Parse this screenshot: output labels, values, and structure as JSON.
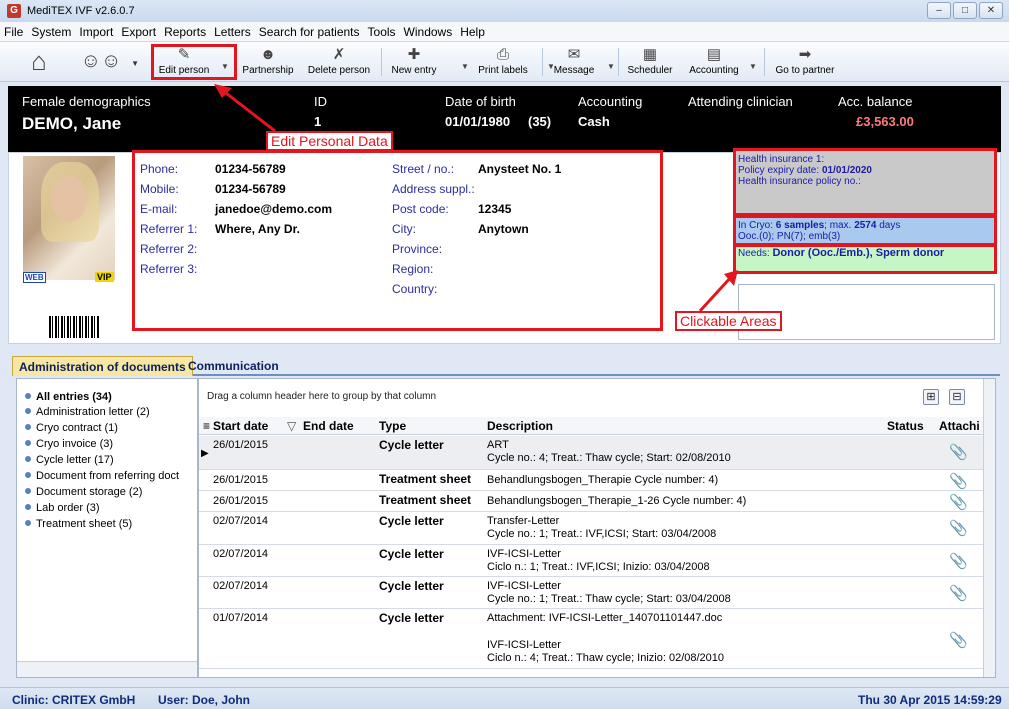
{
  "window": {
    "title": "MediTEX IVF v2.6.0.7",
    "app_icon": "G"
  },
  "menu": [
    "File",
    "System",
    "Import",
    "Export",
    "Reports",
    "Letters",
    "Search for patients",
    "Tools",
    "Windows",
    "Help"
  ],
  "toolbar": {
    "edit_person": "Edit person",
    "partnership": "Partnership",
    "delete_person": "Delete person",
    "new_entry": "New entry",
    "print_labels": "Print labels",
    "message": "Message",
    "scheduler": "Scheduler",
    "accounting": "Accounting",
    "go_to_partner": "Go to partner"
  },
  "header": {
    "demographics_label": "Female demographics",
    "name": "DEMO, Jane",
    "id_label": "ID",
    "id_value": "1",
    "dob_label": "Date of birth",
    "dob_value": "01/01/1980",
    "age": "(35)",
    "accounting_label": "Accounting",
    "accounting_value": "Cash",
    "clinician_label": "Attending clinician",
    "balance_label": "Acc. balance",
    "balance_value": "£3,563.00"
  },
  "badges": {
    "web": "WEB",
    "vip": "VIP"
  },
  "contact": {
    "phone_label": "Phone:",
    "phone": "01234-56789",
    "mobile_label": "Mobile:",
    "mobile": "01234-56789",
    "email_label": "E-mail:",
    "email": "janedoe@demo.com",
    "ref1_label": "Referrer 1:",
    "ref1": "Where, Any Dr.",
    "ref2_label": "Referrer 2:",
    "ref3_label": "Referrer 3:",
    "street_label": "Street / no.:",
    "street": "Anysteet No. 1",
    "address_label": "Address suppl.:",
    "postcode_label": "Post code:",
    "postcode": "12345",
    "city_label": "City:",
    "city": "Anytown",
    "province_label": "Province:",
    "region_label": "Region:",
    "country_label": "Country:"
  },
  "insurance": {
    "line1": "Health insurance 1:",
    "policy_expiry_label": "Policy expiry date:",
    "policy_expiry": "01/01/2020",
    "policy_no": "Health insurance policy no.:"
  },
  "cryo": {
    "line1_prefix": "In Cryo: ",
    "samples": "6 samples",
    "max_text": "; max. ",
    "max_days": "2574",
    "days": " days",
    "line2_prefix": "Ooc.(0); PN(",
    "pn": "7",
    "line2_suffix": "); emb(3)"
  },
  "needs": {
    "label": "Needs: ",
    "value": "Donor (Ooc./Emb.), Sperm donor"
  },
  "annotations": {
    "edit": "Edit Personal Data",
    "clickable": "Clickable Areas"
  },
  "tabs": [
    "Administration of documents",
    "Communication"
  ],
  "doc_tree": [
    "All entries (34)",
    "Administration letter (2)",
    "Cryo contract (1)",
    "Cryo invoice (3)",
    "Cycle letter (17)",
    "Document from referring doct",
    "Document storage (2)",
    "Lab order (3)",
    "Treatment sheet (5)"
  ],
  "grid": {
    "group_hint": "Drag a column header here to group by that column",
    "headers": {
      "start": "Start date",
      "end": "End date",
      "type": "Type",
      "desc": "Description",
      "status": "Status",
      "attach": "Attachi"
    },
    "rows": [
      {
        "start": "26/01/2015",
        "type": "Cycle letter",
        "desc1": "ART",
        "desc2": "Cycle no.: 4; Treat.: Thaw cycle; Start: 02/08/2010",
        "desc3": ""
      },
      {
        "start": "26/01/2015",
        "type": "Treatment sheet",
        "desc1": "Behandlungsbogen_Therapie Cycle number: 4)",
        "desc2": "",
        "desc3": ""
      },
      {
        "start": "26/01/2015",
        "type": "Treatment sheet",
        "desc1": "Behandlungsbogen_Therapie_1-26 Cycle number: 4)",
        "desc2": "",
        "desc3": ""
      },
      {
        "start": "02/07/2014",
        "type": "Cycle letter",
        "desc1": "Transfer-Letter",
        "desc2": "Cycle no.: 1; Treat.: IVF,ICSI; Start: 03/04/2008",
        "desc3": ""
      },
      {
        "start": "02/07/2014",
        "type": "Cycle letter",
        "desc1": "IVF-ICSI-Letter",
        "desc2": "Ciclo n.: 1; Treat.: IVF,ICSI; Inizio:  03/04/2008",
        "desc3": ""
      },
      {
        "start": "02/07/2014",
        "type": "Cycle letter",
        "desc1": "IVF-ICSI-Letter",
        "desc2": "Cycle no.: 1; Treat.: Thaw cycle; Start: 03/04/2008",
        "desc3": ""
      },
      {
        "start": "01/07/2014",
        "type": "Cycle letter",
        "desc1": "Attachment: IVF-ICSI-Letter_140701101447.doc",
        "desc2": "IVF-ICSI-Letter",
        "desc3": "Ciclo n.: 4; Treat.: Thaw cycle; Inizio:  02/08/2010"
      }
    ]
  },
  "status": {
    "clinic": "Clinic: CRITEX GmbH",
    "user": "User: Doe, John",
    "datetime": "Thu 30 Apr 2015 14:59:29"
  }
}
